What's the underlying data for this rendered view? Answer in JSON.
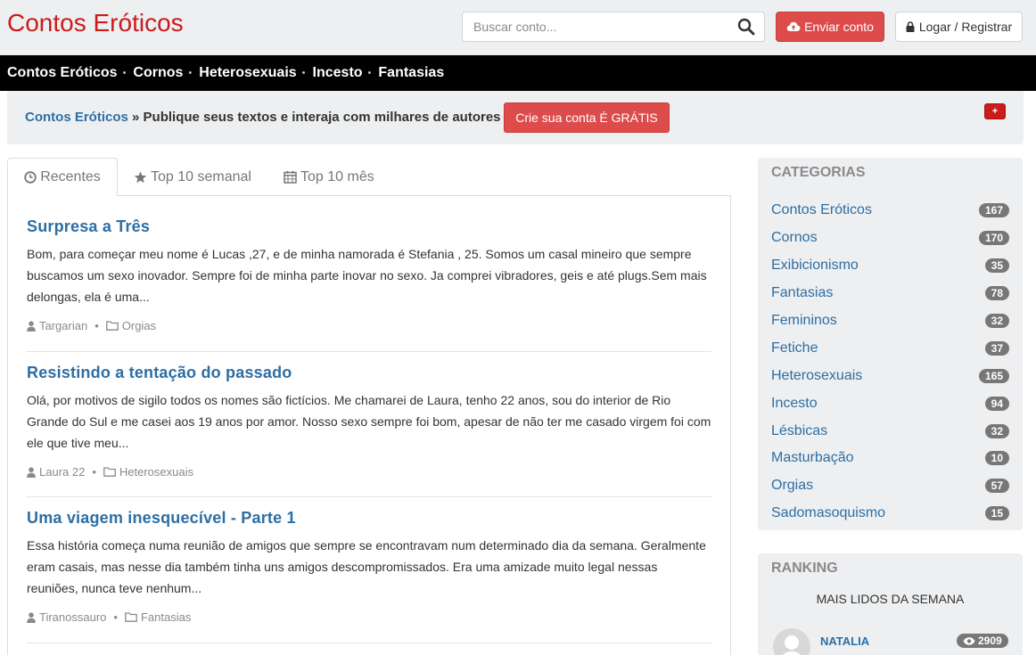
{
  "header": {
    "logo": "Contos Eróticos",
    "search_placeholder": "Buscar conto...",
    "send_label": "Enviar conto",
    "login_label": "Logar / Registrar"
  },
  "nav": {
    "items": [
      "Contos Eróticos",
      "Cornos",
      "Heterosexuais",
      "Incesto",
      "Fantasias"
    ],
    "separator": "•"
  },
  "breadcrumb": {
    "link": "Contos Eróticos",
    "sep": " » ",
    "text": "Publique seus textos e interaja com milhares de autores",
    "signup_label": "Crie sua conta É GRÁTIS",
    "plus_label": "+"
  },
  "tabs": [
    {
      "label": "Recentes",
      "icon": "clock-icon",
      "active": true
    },
    {
      "label": "Top 10 semanal",
      "icon": "star-icon"
    },
    {
      "label": "Top 10 mês",
      "icon": "calendar-icon"
    }
  ],
  "stories": [
    {
      "title": "Surpresa a Três",
      "excerpt": "Bom, para começar meu nome é Lucas ,27, e de minha namorada é Stefania , 25. Somos um casal mineiro que sempre buscamos um sexo inovador. Sempre foi de minha parte inovar no sexo. Ja comprei vibradores, geis e até plugs.Sem mais delongas, ela é uma...",
      "author": "Targarian",
      "category": "Orgias"
    },
    {
      "title": "Resistindo a tentação do passado",
      "excerpt": "Olá, por motivos de sigilo todos os nomes são fictícios. Me chamarei de Laura, tenho 22 anos, sou do interior de Rio Grande do Sul e me casei aos 19 anos por amor. Nosso sexo sempre foi bom, apesar de não ter me casado virgem foi com ele que tive meu...",
      "author": "Laura 22",
      "category": "Heterosexuais"
    },
    {
      "title": "Uma viagem inesquecível - Parte 1",
      "excerpt": "Essa história começa numa reunião de amigos que sempre se encontravam num determinado dia da semana. Geralmente eram casais, mas nesse dia também tinha uns amigos descompromissados. Era uma amizade muito legal nessas reuniões, nunca teve nenhum...",
      "author": "Tiranossauro",
      "category": "Fantasias"
    }
  ],
  "meta_dot": "•",
  "categories": {
    "title": "CATEGORIAS",
    "items": [
      {
        "name": "Contos Eróticos",
        "count": "167"
      },
      {
        "name": "Cornos",
        "count": "170"
      },
      {
        "name": "Exibicionismo",
        "count": "35"
      },
      {
        "name": "Fantasias",
        "count": "78"
      },
      {
        "name": "Femininos",
        "count": "32"
      },
      {
        "name": "Fetiche",
        "count": "37"
      },
      {
        "name": "Heterosexuais",
        "count": "165"
      },
      {
        "name": "Incesto",
        "count": "94"
      },
      {
        "name": "Lésbicas",
        "count": "32"
      },
      {
        "name": "Masturbação",
        "count": "10"
      },
      {
        "name": "Orgias",
        "count": "57"
      },
      {
        "name": "Sadomasoquismo",
        "count": "15"
      }
    ]
  },
  "ranking": {
    "title": "RANKING",
    "subtitle": "MAIS LIDOS DA SEMANA",
    "top": {
      "name": "NATALIA",
      "views": "2909"
    }
  },
  "colors": {
    "brand": "#cc1b1b",
    "link": "#2d6ea3",
    "button_red": "#de4b4b",
    "nav_bg": "#000000",
    "panel_bg": "#eeeff1",
    "badge": "#777777"
  }
}
